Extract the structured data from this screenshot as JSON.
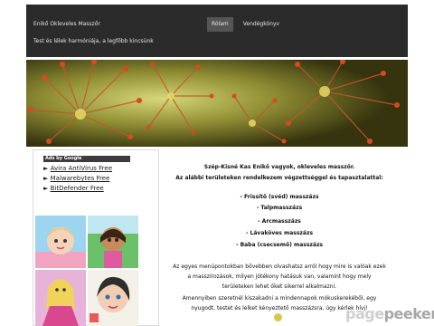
{
  "header": {
    "site_title": "Enikő Okleveles Masszőr",
    "tagline": "Test és lélek harmóniája, a legfőbb kincsünk",
    "nav": [
      {
        "label": "Rólam",
        "active": true
      },
      {
        "label": "Vendégkönyv",
        "active": false
      }
    ]
  },
  "sidebar": {
    "ads_label": "Ads by Google",
    "ad_links": [
      {
        "prefix": "► ",
        "text": "Avira AntiVirus Free"
      },
      {
        "prefix": "► ",
        "text": "Malwarebytes Free"
      },
      {
        "prefix": "► ",
        "text": "BitDefender Free"
      }
    ]
  },
  "content": {
    "intro_1": "Szép-Kisné Kas Enikő vagyok, okleveles masszőr.",
    "intro_2": "Az alábbi területeken rendelkezem végzettséggel és tapasztalattal:",
    "services": [
      "- Frissítő (svéd) masszázs",
      "- Talpmasszázs",
      "- Arcmasszázs",
      "- Lávaköves masszázs",
      "- Baba (csecsemő) masszázs"
    ],
    "para_1_line_1": "Az egyes menüpontokban bővebben olvashatsz arról hogy mire is valóak ezek",
    "para_1_line_2": "a masszírozások, milyen jótékony hatásuk van, valamint hogy mely",
    "para_1_line_3": "területeken lehet őket sikerrel alkalmazni.",
    "para_2_line_1": "Amennyiben szeretnél kiszakadni a mindennapok mókuskerekéből, egy",
    "para_2_line_2": "nyugodt, testet és lelket kényeztető masszázsra, úgy kérlek hívj!"
  },
  "watermark": {
    "part_a": "page",
    "part_b": "peeker"
  },
  "colors": {
    "header_bg": "#2b2b2b",
    "nav_active_bg": "#555555",
    "ads_header_bg": "#3c3c3c"
  }
}
